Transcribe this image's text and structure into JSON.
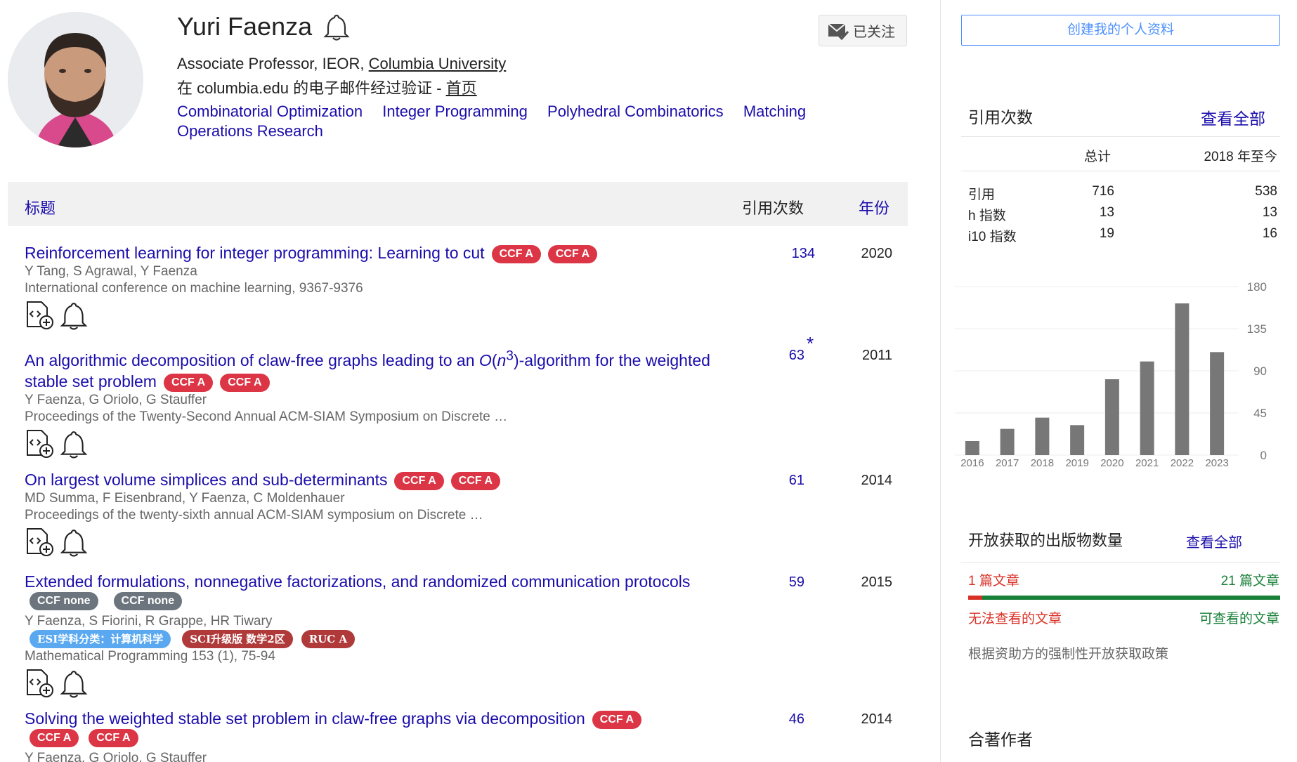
{
  "profile": {
    "name": "Yuri Faenza",
    "affiliation_prefix": "Associate Professor, IEOR, ",
    "affiliation_link": "Columbia University",
    "email_prefix": "在 columbia.edu 的电子邮件经过验证 - ",
    "homepage_label": "首页",
    "follow_label": "已关注",
    "interests": [
      "Combinatorial Optimization",
      "Integer Programming",
      "Polyhedral Combinatorics",
      "Matching",
      "Operations Research"
    ]
  },
  "table_header": {
    "title": "标题",
    "cited_by": "引用次数",
    "year": "年份"
  },
  "publications": [
    {
      "title": "Reinforcement learning for integer programming: Learning to cut",
      "badges": [
        "CCF A",
        "CCF A"
      ],
      "authors": "Y Tang, S Agrawal, Y Faenza",
      "venue": "International conference on machine learning, 9367-9376",
      "cites": "134",
      "year": "2020"
    },
    {
      "title_a": "An algorithmic decomposition of claw-free graphs leading to an ",
      "title_o": "O",
      "title_n": "n",
      "title_sup": "3",
      "title_b": "-algorithm for the weighted stable set problem",
      "badges": [
        "CCF A",
        "CCF A"
      ],
      "authors": "Y Faenza, G Oriolo, G Stauffer",
      "venue": "Proceedings of the Twenty-Second Annual ACM-SIAM Symposium on Discrete …",
      "cites": "63",
      "star": "*",
      "year": "2011"
    },
    {
      "title": "On largest volume simplices and sub-determinants",
      "badges": [
        "CCF A",
        "CCF A"
      ],
      "authors": "MD Summa, F Eisenbrand, Y Faenza, C Moldenhauer",
      "venue": "Proceedings of the twenty-sixth annual ACM-SIAM symposium on Discrete …",
      "cites": "61",
      "year": "2014"
    },
    {
      "title": "Extended formulations, nonnegative factorizations, and randomized communication protocols",
      "badges": [
        "CCF none",
        "CCF none"
      ],
      "authors": "Y Faenza, S Fiorini, R Grappe, HR Tiwary",
      "extra_badges": [
        "ESI学科分类：计算机科学",
        "SCI升级版 数学2区",
        "RUC A"
      ],
      "venue": "Mathematical Programming 153 (1), 75-94",
      "cites": "59",
      "year": "2015"
    },
    {
      "title": "Solving the weighted stable set problem in claw-free graphs via decomposition",
      "badges": [
        "CCF A",
        "CCF A",
        "CCF A"
      ],
      "authors": "Y Faenza, G Oriolo, G Stauffer",
      "cites": "46",
      "year": "2014"
    }
  ],
  "sidebar": {
    "create_profile": "创建我的个人资料",
    "citations_title": "引用次数",
    "view_all": "查看全部",
    "col_total": "总计",
    "col_since": "2018 年至今",
    "rows": [
      {
        "label": "引用",
        "total": "716",
        "since": "538"
      },
      {
        "label": "h 指数",
        "total": "13",
        "since": "13"
      },
      {
        "label": "i10 指数",
        "total": "19",
        "since": "16"
      }
    ],
    "open_access_title": "开放获取的出版物数量",
    "oa_unavailable_count": "1 篇文章",
    "oa_available_count": "21 篇文章",
    "oa_unavailable_label": "无法查看的文章",
    "oa_available_label": "可查看的文章",
    "oa_available_fraction": 0.955,
    "oa_policy": "根据资助方的强制性开放获取政策",
    "coauthors_title": "合著作者"
  },
  "chart_data": {
    "type": "bar",
    "categories": [
      "2016",
      "2017",
      "2018",
      "2019",
      "2020",
      "2021",
      "2022",
      "2023"
    ],
    "values": [
      15,
      28,
      40,
      32,
      81,
      100,
      162,
      110
    ],
    "ylim": [
      0,
      180
    ],
    "yticks": [
      "0",
      "45",
      "90",
      "135",
      "180"
    ],
    "color": "#777777"
  }
}
